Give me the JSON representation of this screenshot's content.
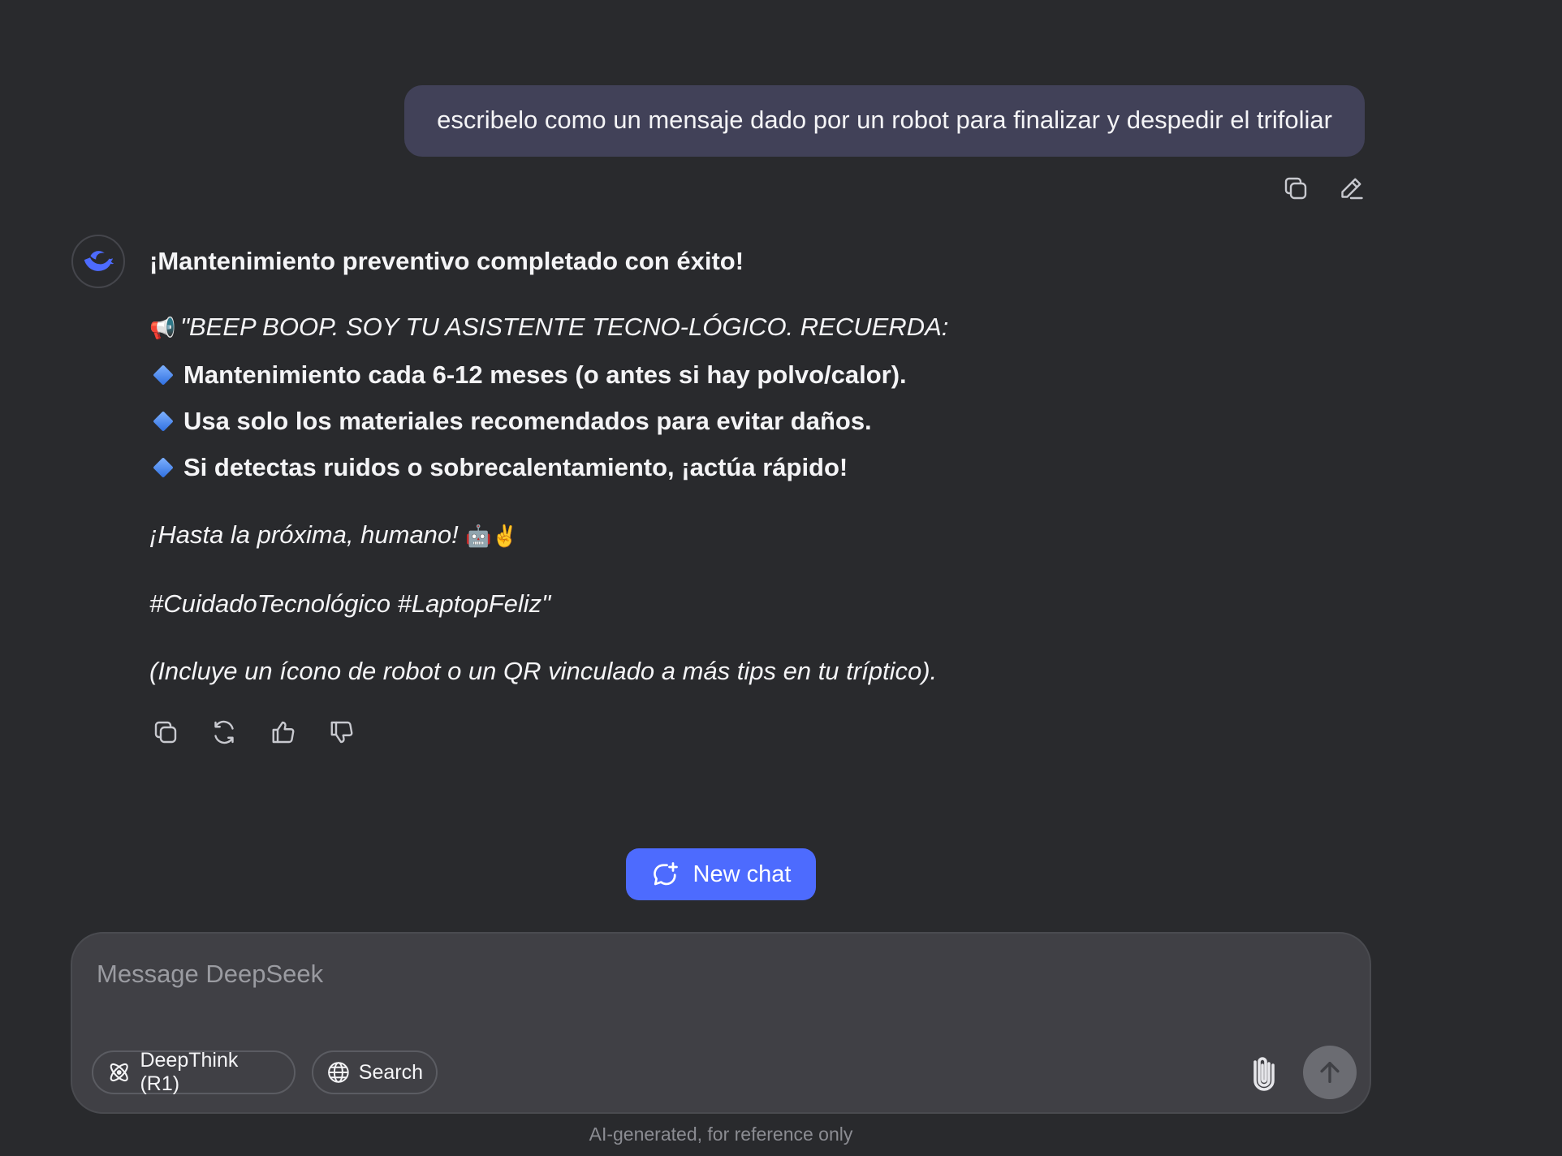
{
  "user_message": {
    "text": "escribelo como un mensaje dado por un robot para finalizar y despedir el trifoliar"
  },
  "user_actions": {
    "copy_icon": "copy-icon",
    "edit_icon": "edit-icon"
  },
  "assistant": {
    "avatar_icon": "deepseek-whale-icon",
    "heading": "¡Mantenimiento preventivo completado con éxito!",
    "intro_emoji": "📢",
    "intro": "\"BEEP BOOP. SOY TU ASISTENTE TECNO-LÓGICO. RECUERDA:",
    "bullets": [
      "Mantenimiento cada 6-12 meses (o antes si hay polvo/calor).",
      "Usa solo los materiales recomendados para evitar daños.",
      "Si detectas ruidos o sobrecalentamiento, ¡actúa rápido!"
    ],
    "farewell": "¡Hasta la próxima, humano!",
    "farewell_emoji": "🤖✌️",
    "hashtags": "#CuidadoTecnológico #LaptopFeliz\"",
    "note": "(Incluye un ícono de robot o un QR vinculado a más tips en tu tríptico)."
  },
  "answer_actions": {
    "copy_icon": "copy-icon",
    "regenerate_icon": "regenerate-icon",
    "like_icon": "thumbs-up-icon",
    "dislike_icon": "thumbs-down-icon"
  },
  "new_chat": {
    "label": "New chat",
    "color": "#4d6bfe"
  },
  "composer": {
    "placeholder": "Message DeepSeek",
    "value": "",
    "deepthink_label": "DeepThink (R1)",
    "search_label": "Search"
  },
  "disclaimer": "AI-generated, for reference only",
  "colors": {
    "background": "#292a2d",
    "user_bubble": "#414158",
    "composer": "#404045",
    "accent": "#4d6bfe"
  }
}
